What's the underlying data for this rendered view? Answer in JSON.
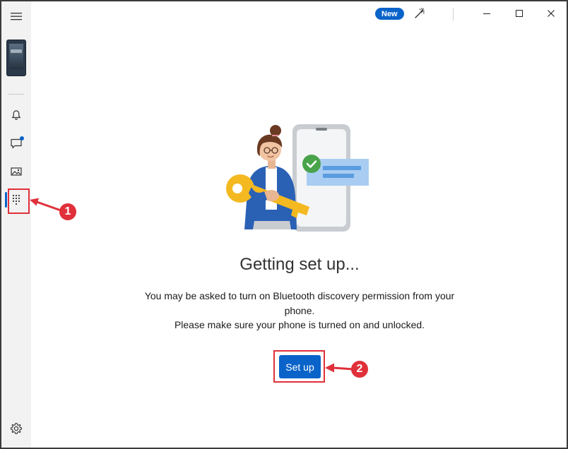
{
  "titlebar": {
    "badge_label": "New"
  },
  "sidebar": {
    "items": [
      {
        "name": "menu",
        "icon": "hamburger-icon"
      },
      {
        "name": "phone",
        "icon": "phone-thumbnail"
      },
      {
        "name": "notifications",
        "icon": "bell-icon"
      },
      {
        "name": "messages",
        "icon": "chat-icon",
        "has_unread_dot": true
      },
      {
        "name": "photos",
        "icon": "image-icon"
      },
      {
        "name": "apps",
        "icon": "dialpad-icon",
        "active": true
      },
      {
        "name": "settings",
        "icon": "gear-icon"
      }
    ]
  },
  "main": {
    "heading": "Getting set up...",
    "description": [
      "You may be asked to turn on Bluetooth discovery permission from your phone.",
      "Please make sure your phone is turned on and unlocked."
    ],
    "setup_button_label": "Set up"
  },
  "annotations": [
    {
      "number": "1",
      "target": "apps"
    },
    {
      "number": "2",
      "target": "setup-button"
    }
  ],
  "colors": {
    "accent": "#0a63c9",
    "highlight": "#e0303a",
    "sidebar_bg": "#f2f2f2"
  }
}
